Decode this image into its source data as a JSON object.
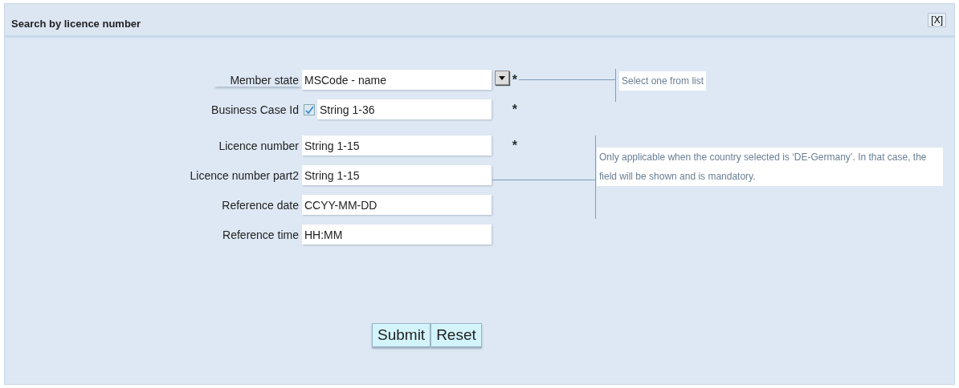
{
  "window": {
    "title": "Search by licence number",
    "close": "[X]"
  },
  "fields": [
    {
      "kind": "select",
      "label": "Member state",
      "value": "MSCode - name",
      "required_mark": "*"
    },
    {
      "kind": "checkbox_text",
      "label": "Business Case Id",
      "checked": true,
      "placeholder": "String 1-36",
      "required_mark": "*"
    },
    {
      "kind": "text",
      "label": "Licence number",
      "placeholder": "String 1-15",
      "required_mark": "*"
    },
    {
      "kind": "text",
      "label": "Licence number part2",
      "placeholder": "String 1-15"
    },
    {
      "kind": "text",
      "label": "Reference date",
      "placeholder": "CCYY-MM-DD"
    },
    {
      "kind": "text",
      "label": "Reference time",
      "placeholder": "HH:MM"
    }
  ],
  "notes": [
    {
      "text": "Select one from list"
    },
    {
      "text": "Only applicable when the country selected is ‘DE-Germany’. In that case, the field will be shown and is mandatory."
    }
  ],
  "buttons": [
    "Submit",
    "Reset"
  ]
}
